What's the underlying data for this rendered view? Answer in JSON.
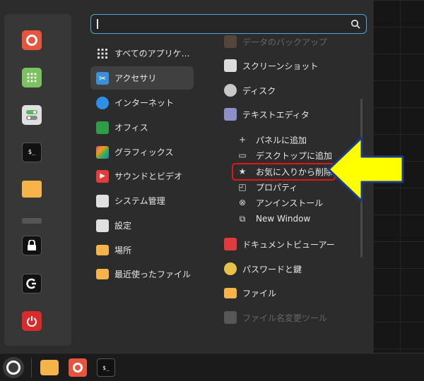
{
  "search": {
    "placeholder": ""
  },
  "favorites": [
    {
      "name": "firefox-icon"
    },
    {
      "name": "apps-grid-icon"
    },
    {
      "name": "toggle-settings-icon"
    },
    {
      "name": "terminal-icon"
    },
    {
      "name": "folder-icon"
    },
    {
      "name": "lock-icon"
    },
    {
      "name": "logout-icon"
    },
    {
      "name": "power-icon"
    }
  ],
  "terminal_prompt": "$_",
  "categories": [
    {
      "label": "すべてのアプリケ…",
      "icon": "grid-icon"
    },
    {
      "label": "アクセサリ",
      "icon": "scissors-icon",
      "selected": true
    },
    {
      "label": "インターネット",
      "icon": "cloud-icon"
    },
    {
      "label": "オフィス",
      "icon": "office-icon"
    },
    {
      "label": "グラフィックス",
      "icon": "graphics-icon"
    },
    {
      "label": "サウンドとビデオ",
      "icon": "play-icon"
    },
    {
      "label": "システム管理",
      "icon": "system-icon"
    },
    {
      "label": "設定",
      "icon": "settings-icon"
    },
    {
      "label": "場所",
      "icon": "folder-icon"
    },
    {
      "label": "最近使ったファイル",
      "icon": "recent-files-icon"
    }
  ],
  "apps": {
    "partial_top": "データのバックアップ",
    "screenshot": "スクリーンショット",
    "disk": "ディスク",
    "text_editor": "テキストエディタ",
    "document_viewer": "ドキュメントビューアー",
    "passwords": "パスワードと鍵",
    "files": "ファイル",
    "rename": "ファイル名変更ツール"
  },
  "context_menu": {
    "add_panel": "パネルに追加",
    "add_desktop": "デスクトップに追加",
    "remove_favorite": "お気に入りから削除",
    "properties": "プロパティ",
    "uninstall": "アンインストール",
    "new_window": "New Window"
  },
  "colors": {
    "highlight_border": "#e01717",
    "arrow_fill": "#ffff00",
    "arrow_stroke": "#1a3a8a",
    "search_border": "#4da6d6"
  }
}
